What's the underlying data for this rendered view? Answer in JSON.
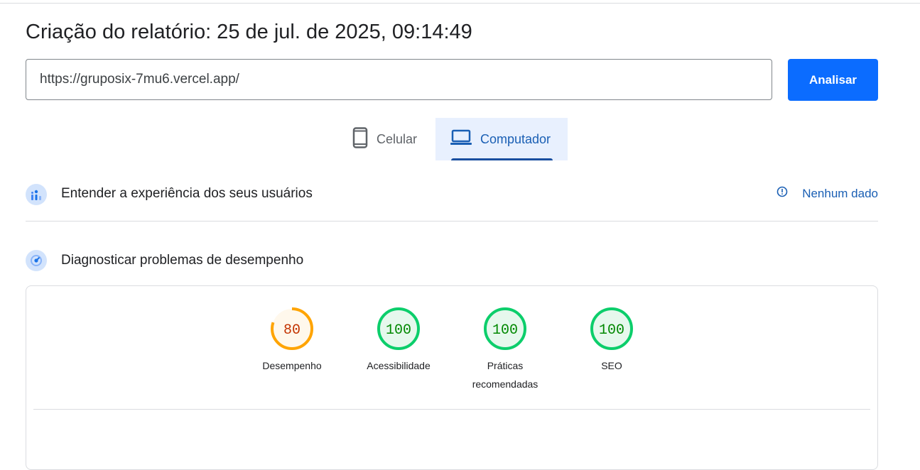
{
  "page": {
    "title": "Criação do relatório: 25 de jul. de 2025, 09:14:49"
  },
  "search": {
    "url_value": "https://gruposix-7mu6.vercel.app/",
    "analyze_label": "Analisar",
    "accent_color": "#0b6cff"
  },
  "tabs": [
    {
      "label": "Celular",
      "icon": "smartphone-icon",
      "selected": false
    },
    {
      "label": "Computador",
      "icon": "laptop-icon",
      "selected": true
    }
  ],
  "field_data": {
    "title": "Entender a experiência dos seus usuários",
    "icon": "users-chart-icon",
    "status_label": "Nenhum dado",
    "status_icon": "info-icon"
  },
  "diagnostics": {
    "title": "Diagnosticar problemas de desempenho",
    "icon": "speedometer-icon",
    "scores": [
      {
        "label": "Desempenho",
        "value": 80,
        "color": "#ffa400",
        "text_color": "#c33300",
        "fill": "#fff8ec"
      },
      {
        "label": "Acessibilidade",
        "value": 100,
        "color": "#0cce6b",
        "text_color": "#008800",
        "fill": "#e6f8ed"
      },
      {
        "label": "Práticas recomendadas",
        "value": 100,
        "color": "#0cce6b",
        "text_color": "#008800",
        "fill": "#e6f8ed"
      },
      {
        "label": "SEO",
        "value": 100,
        "color": "#0cce6b",
        "text_color": "#008800",
        "fill": "#e6f8ed"
      }
    ]
  }
}
